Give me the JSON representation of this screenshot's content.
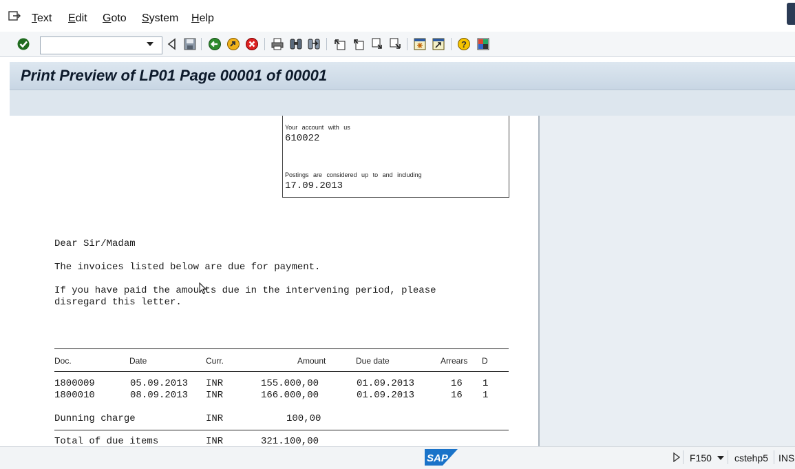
{
  "menu": {
    "items": [
      "Text",
      "Edit",
      "Goto",
      "System",
      "Help"
    ],
    "first_letters": [
      "T",
      "E",
      "G",
      "S",
      "H"
    ],
    "rests": [
      "ext",
      "dit",
      "oto",
      "ystem",
      "elp"
    ]
  },
  "toolbar": {
    "command_field_value": "",
    "icons": [
      "enter-checkmark-icon",
      "back-triangle-icon",
      "save-icon",
      "back-green-icon",
      "exit-yellow-icon",
      "cancel-red-icon",
      "print-icon",
      "find-icon",
      "find-next-icon",
      "first-page-icon",
      "previous-page-icon",
      "next-page-icon",
      "last-page-icon",
      "create-session-icon",
      "shortcut-icon",
      "help-icon",
      "customize-layout-icon"
    ]
  },
  "title": "Print Preview of LP01 Page 00001 of 00001",
  "document": {
    "account_label": "Your account with us",
    "account_value": "610022",
    "postings_label": "Postings are considered up to and including",
    "postings_value": "17.09.2013",
    "salutation": "Dear Sir/Madam",
    "line1": "The invoices listed below are due for payment.",
    "line2a": "If you have paid the amounts due in the intervening period, please",
    "line2b": "disregard this letter.",
    "table": {
      "headers": [
        "Doc.",
        "Date",
        "Curr.",
        "Amount",
        "Due date",
        "Arrears",
        "D"
      ],
      "rows": [
        [
          "1800009",
          "05.09.2013",
          "INR",
          "155.000,00",
          "01.09.2013",
          "16",
          "1"
        ],
        [
          "1800010",
          "08.09.2013",
          "INR",
          "166.000,00",
          "01.09.2013",
          "16",
          "1"
        ]
      ],
      "dunning_label": "Dunning charge",
      "dunning_curr": "INR",
      "dunning_amount": "100,00",
      "total_label": "Total of due items",
      "total_curr": "INR",
      "total_amount": "321.100,00"
    }
  },
  "status": {
    "logo": "SAP",
    "transaction": "F150",
    "server": "cstehp5",
    "mode": "INS"
  },
  "colors": {
    "title_bg": "#c8d6e4",
    "sap_blue": "#1a73c9"
  }
}
